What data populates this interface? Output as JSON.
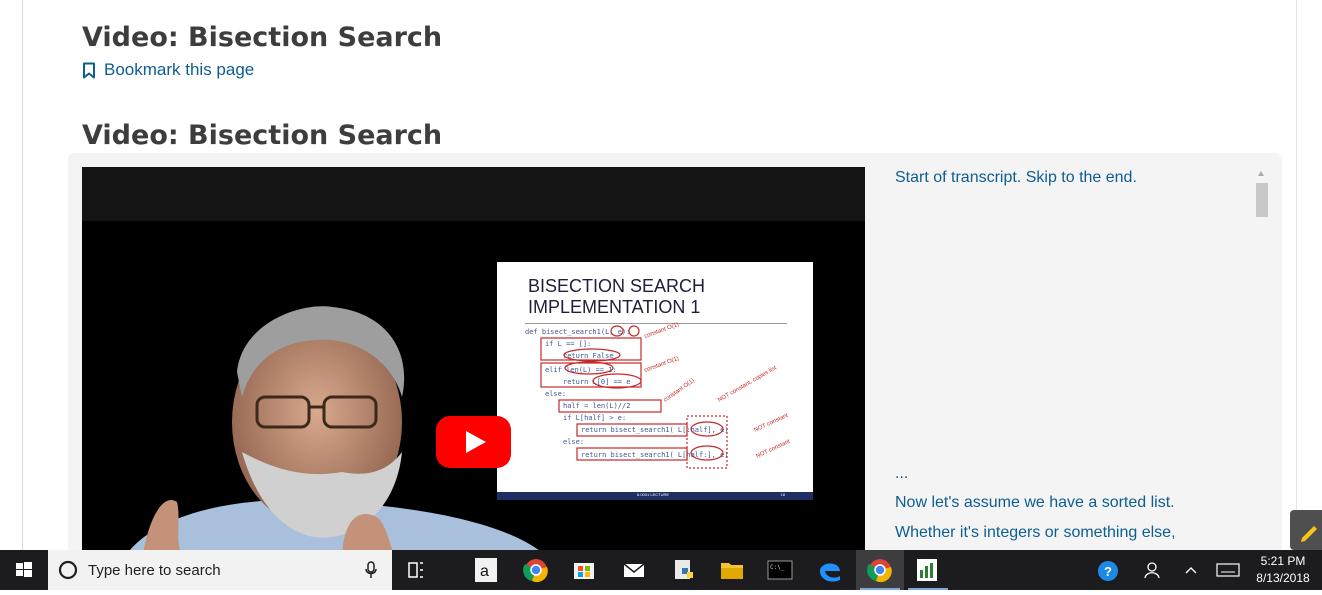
{
  "page": {
    "title_top": "Video: Bisection Search",
    "bookmark_label": "Bookmark this page",
    "title_video": "Video: Bisection Search"
  },
  "video": {
    "slide_title": "BISECTION SEARCH\nIMPLEMENTATION 1",
    "code_lines": [
      "def bisect_search1(L, e):",
      "if L == []:",
      "return False",
      "elif len(L) == 1:",
      "return L[0] == e",
      "else:",
      "half = len(L)//2",
      "if L[half] > e:",
      "return bisect_search1( L[:half], e)",
      "else:",
      "return bisect_search1( L[half:], e)"
    ],
    "annotations": [
      "constant O(1)",
      "constant O(1)",
      "constant O(1)",
      "NOT constant, copies list",
      "NOT constant",
      "NOT constant"
    ],
    "slide_footer": "6.0001 LECTURE",
    "slide_number": "18",
    "play_icon": "youtube-play-icon"
  },
  "transcript": {
    "start_link": "Start of transcript. Skip to the end.",
    "lines": [
      "...",
      "Now let's assume we have a sorted list.",
      "Whether it's integers or something else,"
    ]
  },
  "taskbar": {
    "search_placeholder": "Type here to search",
    "time": "5:21 PM",
    "date": "8/13/2018"
  },
  "colors": {
    "link": "#0d5d93",
    "play_red": "#ff0000",
    "taskbar_bg": "#1c1c1e"
  }
}
